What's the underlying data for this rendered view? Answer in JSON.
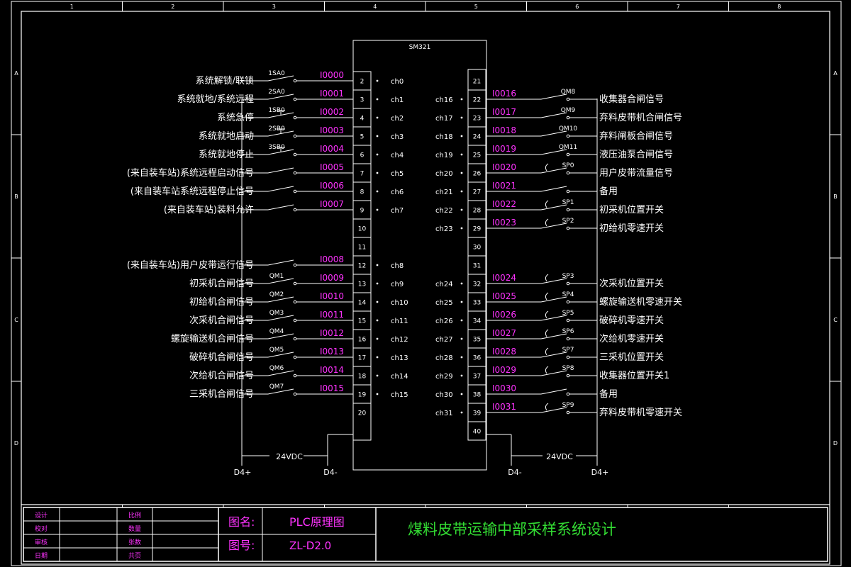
{
  "colors": {
    "background": "#000000",
    "line": "#ffffff",
    "address": "#ff33ff",
    "title_block_label": "#ff33ff",
    "project_title": "#33dd33"
  },
  "frame": {
    "col_labels": [
      "1",
      "2",
      "3",
      "4",
      "5",
      "6",
      "7",
      "8"
    ],
    "row_labels": [
      "A",
      "B",
      "C",
      "D"
    ]
  },
  "module": {
    "name": "SM321"
  },
  "left_inputs": [
    {
      "label": "系统解锁/联锁",
      "device": "1SA0",
      "address": "I0000",
      "term": "2",
      "channel": "ch0",
      "kind": "switch"
    },
    {
      "label": "系统就地/系统远程",
      "device": "2SA0",
      "address": "I0001",
      "term": "3",
      "channel": "ch1",
      "kind": "switch"
    },
    {
      "label": "系统急停",
      "device": "1SB0",
      "address": "I0002",
      "term": "4",
      "channel": "ch2",
      "kind": "pushbutton"
    },
    {
      "label": "系统就地启动",
      "device": "2SB0",
      "address": "I0003",
      "term": "5",
      "channel": "ch3",
      "kind": "pushbutton"
    },
    {
      "label": "系统就地停止",
      "device": "3SB0",
      "address": "I0004",
      "term": "6",
      "channel": "ch4",
      "kind": "pushbutton"
    },
    {
      "label": "(来自装车站)系统远程启动信号",
      "device": "",
      "address": "I0005",
      "term": "7",
      "channel": "ch5",
      "kind": "switch"
    },
    {
      "label": "(来自装车站系统远程停止信号",
      "device": "",
      "address": "I0006",
      "term": "8",
      "channel": "ch6",
      "kind": "switch"
    },
    {
      "label": "(来自装车站)装料允许",
      "device": "",
      "address": "I0007",
      "term": "9",
      "channel": "ch7",
      "kind": "switch"
    },
    {
      "label": "",
      "device": "",
      "address": "",
      "term": "10",
      "channel": "",
      "kind": "none"
    },
    {
      "label": "",
      "device": "",
      "address": "",
      "term": "11",
      "channel": "",
      "kind": "none"
    },
    {
      "label": "(来自装车站)用户皮带运行信号",
      "device": "",
      "address": "I0008",
      "term": "12",
      "channel": "ch8",
      "kind": "switch"
    },
    {
      "label": "初采机合闸信号",
      "device": "QM1",
      "address": "I0009",
      "term": "13",
      "channel": "ch9",
      "kind": "switch"
    },
    {
      "label": "初给机合闸信号",
      "device": "QM2",
      "address": "I0010",
      "term": "14",
      "channel": "ch10",
      "kind": "switch"
    },
    {
      "label": "次采机合闸信号",
      "device": "QM3",
      "address": "I0011",
      "term": "15",
      "channel": "ch11",
      "kind": "switch"
    },
    {
      "label": "螺旋输送机合闸信号",
      "device": "QM4",
      "address": "I0012",
      "term": "16",
      "channel": "ch12",
      "kind": "switch"
    },
    {
      "label": "破碎机合闸信号",
      "device": "QM5",
      "address": "I0013",
      "term": "17",
      "channel": "ch13",
      "kind": "switch"
    },
    {
      "label": "次给机合闸信号",
      "device": "QM6",
      "address": "I0014",
      "term": "18",
      "channel": "ch14",
      "kind": "switch"
    },
    {
      "label": "三采机合闸信号",
      "device": "QM7",
      "address": "I0015",
      "term": "19",
      "channel": "ch15",
      "kind": "switch"
    },
    {
      "label": "",
      "device": "",
      "address": "",
      "term": "20",
      "channel": "",
      "kind": "none"
    }
  ],
  "right_inputs": [
    {
      "label": "",
      "device": "",
      "address": "",
      "term": "21",
      "channel": "",
      "kind": "none"
    },
    {
      "label": "收集器合闸信号",
      "device": "QM8",
      "address": "I0016",
      "term": "22",
      "channel": "ch16",
      "kind": "switch"
    },
    {
      "label": "弃料皮带机合闸信号",
      "device": "QM9",
      "address": "I0017",
      "term": "23",
      "channel": "ch17",
      "kind": "switch"
    },
    {
      "label": "弃料闸板合闸信号",
      "device": "QM10",
      "address": "I0018",
      "term": "24",
      "channel": "ch18",
      "kind": "switch"
    },
    {
      "label": "液压油泵合闸信号",
      "device": "QM11",
      "address": "I0019",
      "term": "25",
      "channel": "ch19",
      "kind": "switch"
    },
    {
      "label": "用户皮带流量信号",
      "device": "SP0",
      "address": "I0020",
      "term": "26",
      "channel": "ch20",
      "kind": "sensor"
    },
    {
      "label": "备用",
      "device": "",
      "address": "I0021",
      "term": "27",
      "channel": "ch21",
      "kind": "switch"
    },
    {
      "label": "初采机位置开关",
      "device": "SP1",
      "address": "I0022",
      "term": "28",
      "channel": "ch22",
      "kind": "sensor"
    },
    {
      "label": "初给机零速开关",
      "device": "SP2",
      "address": "I0023",
      "term": "29",
      "channel": "ch23",
      "kind": "sensor"
    },
    {
      "label": "",
      "device": "",
      "address": "",
      "term": "30",
      "channel": "",
      "kind": "none"
    },
    {
      "label": "",
      "device": "",
      "address": "",
      "term": "31",
      "channel": "",
      "kind": "none"
    },
    {
      "label": "次采机位置开关",
      "device": "SP3",
      "address": "I0024",
      "term": "32",
      "channel": "ch24",
      "kind": "sensor"
    },
    {
      "label": "螺旋输送机零速开关",
      "device": "SP4",
      "address": "I0025",
      "term": "33",
      "channel": "ch25",
      "kind": "sensor"
    },
    {
      "label": "破碎机零速开关",
      "device": "SP5",
      "address": "I0026",
      "term": "34",
      "channel": "ch26",
      "kind": "sensor"
    },
    {
      "label": "次给机零速开关",
      "device": "SP6",
      "address": "I0027",
      "term": "35",
      "channel": "ch27",
      "kind": "sensor"
    },
    {
      "label": "三采机位置开关",
      "device": "SP7",
      "address": "I0028",
      "term": "36",
      "channel": "ch28",
      "kind": "sensor"
    },
    {
      "label": "收集器位置开关1",
      "device": "SP8",
      "address": "I0029",
      "term": "37",
      "channel": "ch29",
      "kind": "sensor"
    },
    {
      "label": "备用",
      "device": "",
      "address": "I0030",
      "term": "38",
      "channel": "ch30",
      "kind": "switch"
    },
    {
      "label": "弃料皮带机零速开关",
      "device": "SP9",
      "address": "I0031",
      "term": "39",
      "channel": "ch31",
      "kind": "sensor"
    },
    {
      "label": "",
      "device": "",
      "address": "",
      "term": "40",
      "channel": "",
      "kind": "none"
    }
  ],
  "power": {
    "voltage": "24VDC",
    "left_plus": "D4+",
    "left_minus": "D4-",
    "right_minus": "D4-",
    "right_plus": "D4+"
  },
  "title_block": {
    "roles_left": [
      "设计",
      "校对",
      "审核",
      "日期"
    ],
    "roles_right": [
      "比例",
      "数量",
      "张数",
      "共页"
    ],
    "drawing_name_label": "图名:",
    "drawing_name": "PLC原理图",
    "drawing_no_label": "图号:",
    "drawing_no": "ZL-D2.0",
    "project_title": "煤料皮带运输中部采样系统设计"
  }
}
